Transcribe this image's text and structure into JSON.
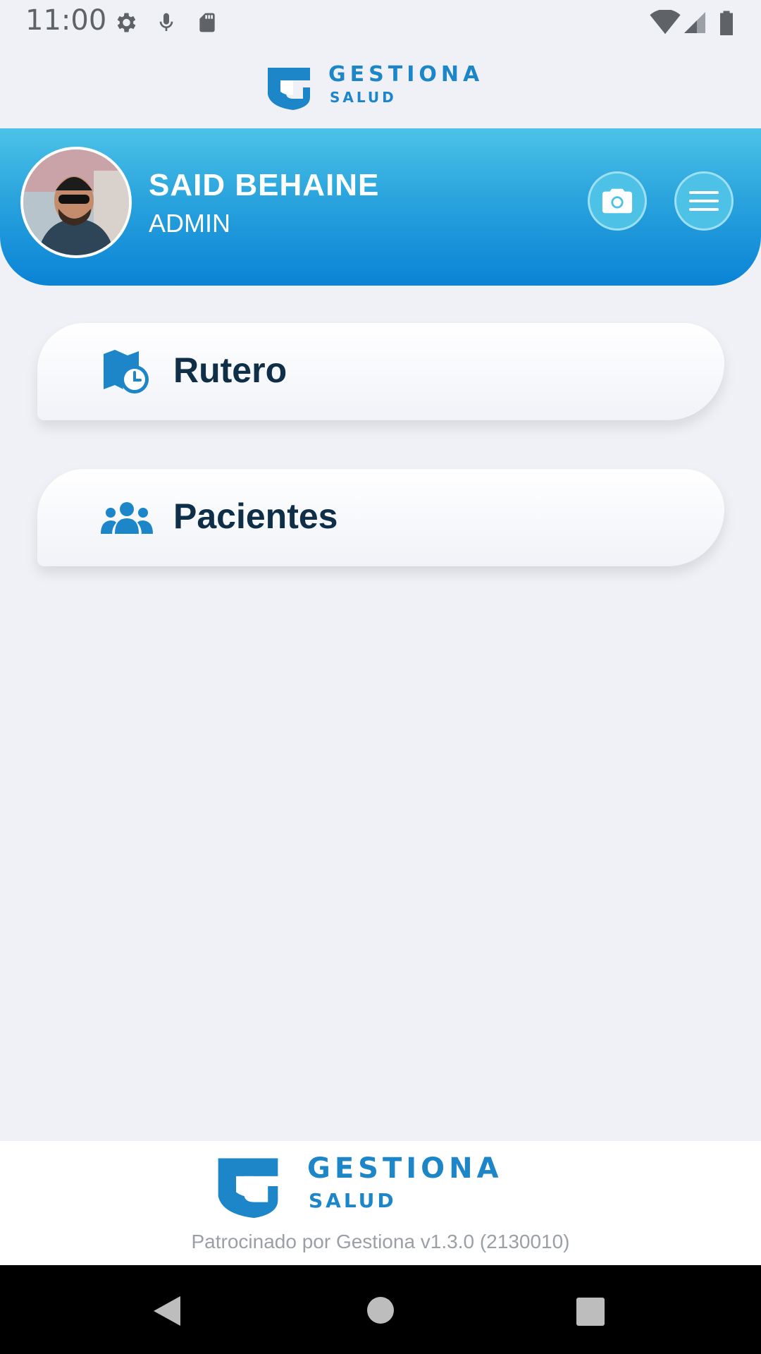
{
  "status_bar": {
    "time": "11:00",
    "icons_left": [
      "gear-icon",
      "mic-icon",
      "sd-card-icon"
    ],
    "icons_right": [
      "wifi-icon",
      "cell-signal-icon",
      "battery-icon"
    ]
  },
  "brand": {
    "logo_text": "GESTIONA",
    "logo_sub": "SALUD",
    "color": "#1d86c9"
  },
  "header": {
    "user_name": "SAID BEHAINE",
    "user_role": "ADMIN",
    "camera_icon": "camera-icon",
    "menu_icon": "hamburger-menu-icon",
    "gradient": [
      "#4bc3e8",
      "#0a83d6"
    ]
  },
  "menu": {
    "items": [
      {
        "label": "Rutero",
        "icon": "map-clock-icon"
      },
      {
        "label": "Pacientes",
        "icon": "users-group-icon"
      }
    ]
  },
  "footer": {
    "logo_text": "GESTIONA",
    "logo_sub": "SALUD",
    "sponsor_text": "Patrocinado por Gestiona v1.3.0 (2130010)"
  },
  "nav_bar": {
    "icons": [
      "back-icon",
      "home-icon",
      "recents-icon"
    ]
  }
}
